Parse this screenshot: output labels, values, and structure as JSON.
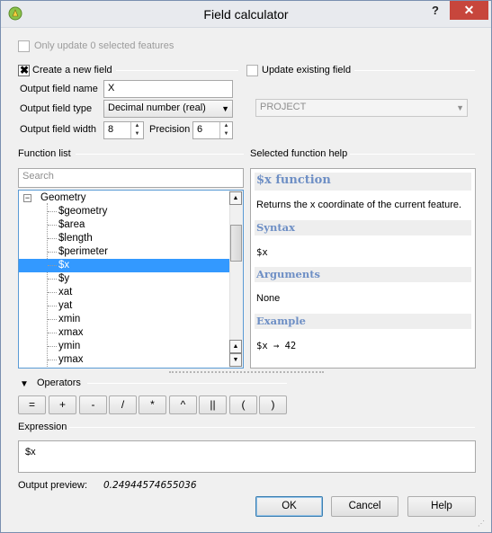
{
  "window": {
    "title": "Field calculator",
    "help_glyph": "?",
    "close_glyph": "✕"
  },
  "only_update_label": "Only update 0 selected features",
  "create_new_field": {
    "label": "Create a new field",
    "checked": true
  },
  "update_existing_field": {
    "label": "Update existing field",
    "checked": false,
    "combo_value": "PROJECT"
  },
  "output_field_name": {
    "label": "Output field name",
    "value": "X"
  },
  "output_field_type": {
    "label": "Output field type",
    "value": "Decimal number (real)"
  },
  "output_field_width": {
    "label": "Output field width",
    "value": "8"
  },
  "precision": {
    "label": "Precision",
    "value": "6"
  },
  "function_list": {
    "label": "Function list",
    "search_placeholder": "Search",
    "group": "Geometry",
    "items": [
      "$geometry",
      "$area",
      "$length",
      "$perimeter",
      "$x",
      "$y",
      "xat",
      "yat",
      "xmin",
      "xmax",
      "ymin",
      "ymax"
    ],
    "selected_index": 4
  },
  "function_help": {
    "label": "Selected function help",
    "title": "$x function",
    "description": "Returns the x coordinate of the current feature.",
    "syntax_heading": "Syntax",
    "syntax": "$x",
    "arguments_heading": "Arguments",
    "arguments": "None",
    "example_heading": "Example",
    "example": "$x → 42"
  },
  "operators": {
    "label": "Operators",
    "buttons": [
      "=",
      "+",
      "-",
      "/",
      "*",
      "^",
      "||",
      "(",
      ")"
    ]
  },
  "expression": {
    "label": "Expression",
    "value": "$x"
  },
  "output_preview": {
    "label": "Output preview:",
    "value": "0.24944574655036"
  },
  "buttons": {
    "ok": "OK",
    "cancel": "Cancel",
    "help": "Help"
  },
  "colors": {
    "accent": "#3399ff",
    "help_heading": "#6e8fc5",
    "close_button": "#c7463c"
  }
}
